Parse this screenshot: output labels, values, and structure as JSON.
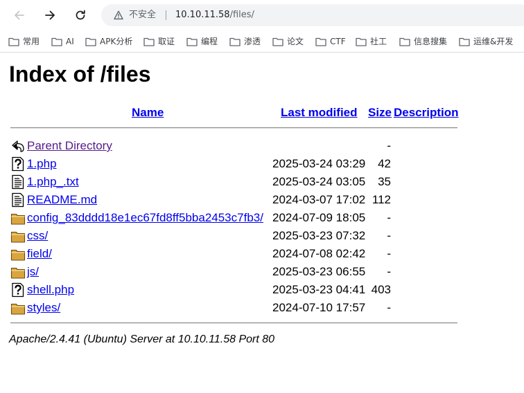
{
  "browser": {
    "security_label": "不安全",
    "url_host": "10.10.11.58",
    "url_path": "/files/",
    "bookmarks": [
      "常用",
      "AI",
      "APK分析",
      "取证",
      "编程",
      "渗透",
      "论文",
      "CTF",
      "社工",
      "信息搜集",
      "运维&开发"
    ]
  },
  "page": {
    "title": "Index of /files",
    "headers": {
      "name": "Name",
      "last_modified": "Last modified",
      "size": "Size",
      "description": "Description"
    },
    "rows": [
      {
        "name": "Parent Directory",
        "date": "",
        "size": "-",
        "icon": "back-icon"
      },
      {
        "name": "1.php",
        "date": "2025-03-24 03:29",
        "size": "42",
        "icon": "unknown-file-icon"
      },
      {
        "name": "1.php_.txt",
        "date": "2025-03-24 03:05",
        "size": "35",
        "icon": "text-file-icon"
      },
      {
        "name": "README.md",
        "date": "2024-03-07 17:02",
        "size": "112",
        "icon": "text-file-icon"
      },
      {
        "name": "config_83dddd18e1ec67fd8ff5bba2453c7fb3/",
        "date": "2024-07-09 18:05",
        "size": "-",
        "icon": "folder-icon"
      },
      {
        "name": "css/",
        "date": "2025-03-23 07:32",
        "size": "-",
        "icon": "folder-icon"
      },
      {
        "name": "field/",
        "date": "2024-07-08 02:42",
        "size": "-",
        "icon": "folder-icon"
      },
      {
        "name": "js/",
        "date": "2025-03-23 06:55",
        "size": "-",
        "icon": "folder-icon"
      },
      {
        "name": "shell.php",
        "date": "2025-03-23 04:41",
        "size": "403",
        "icon": "unknown-file-icon"
      },
      {
        "name": "styles/",
        "date": "2024-07-10 17:57",
        "size": "-",
        "icon": "folder-icon"
      }
    ],
    "footer": "Apache/2.4.41 (Ubuntu) Server at 10.10.11.58 Port 80"
  }
}
